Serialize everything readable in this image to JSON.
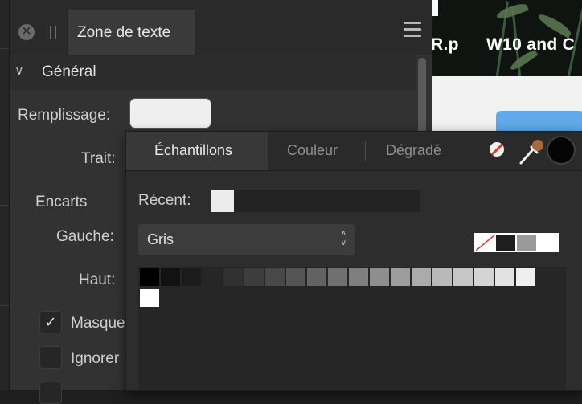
{
  "background": {
    "title_fragment_1": "R.p",
    "title_fragment_2": "W10 and C"
  },
  "text_frame_panel": {
    "title": "Zone de texte",
    "close_icon": "close-icon",
    "menu_icon": "hamburger-menu-icon",
    "section": {
      "label": "Général",
      "expanded_icon": "chevron-down-icon"
    },
    "fill_label": "Remplissage:",
    "fill_color": "#efefef",
    "stroke_label": "Trait:",
    "insets_label": "Encarts",
    "left_label": "Gauche:",
    "top_label": "Haut:",
    "checkbox_1": {
      "label": "Masque",
      "checked": true
    },
    "checkbox_2": {
      "label": "Ignorer",
      "checked": false
    }
  },
  "color_popover": {
    "tabs": [
      {
        "label": "Échantillons",
        "active": true
      },
      {
        "label": "Couleur",
        "active": false
      },
      {
        "label": "Dégradé",
        "active": false
      }
    ],
    "icons": [
      "no-color-icon",
      "color-picker-icon",
      "current-color-swatch"
    ],
    "current_color": "#050505",
    "recent_label": "Récent:",
    "recent_colors": [
      "#ececec"
    ],
    "palette_name": "Gris",
    "quick_swatches": [
      "none",
      "#1e1e1e",
      "#9a9a9a",
      "#ffffff"
    ],
    "grey_swatches": [
      "#000000",
      "#121212",
      "#1b1b1b",
      "#262626",
      "#303030",
      "#3d3d3d",
      "#484848",
      "#545454",
      "#626262",
      "#707070",
      "#7f7f7f",
      "#8e8e8e",
      "#9d9d9d",
      "#ababab",
      "#b9b9b9",
      "#c6c6c6",
      "#d4d4d4",
      "#e2e2e2",
      "#efefef",
      "#ffffff"
    ]
  }
}
